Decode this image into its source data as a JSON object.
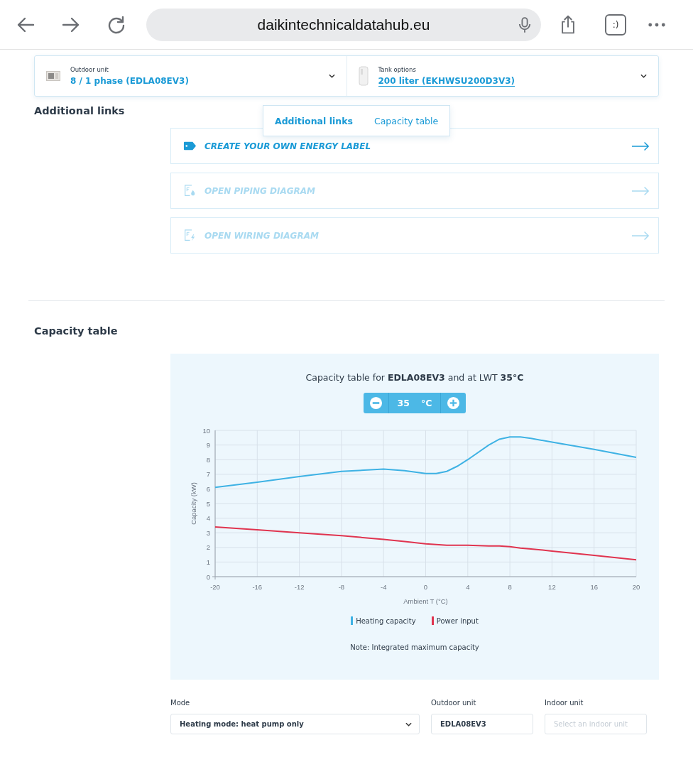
{
  "browser": {
    "url": "daikintechnicaldatahub.eu",
    "tabs_badge": ":)"
  },
  "selectors": [
    {
      "label": "Outdoor unit",
      "value": "8 / 1 phase (EDLA08EV3)",
      "kind": "outdoor"
    },
    {
      "label": "Tank options",
      "value": "200 liter (EKHWSU200D3V3)",
      "kind": "tank"
    }
  ],
  "section_tabs": [
    {
      "label": "Additional links",
      "selected": true
    },
    {
      "label": "Capacity table",
      "selected": false
    }
  ],
  "additional_links": {
    "heading": "Additional links",
    "items": [
      {
        "label": "CREATE YOUR OWN ENERGY LABEL",
        "kind": "tag",
        "disabled": false
      },
      {
        "label": "OPEN PIPING DIAGRAM",
        "kind": "piping",
        "disabled": true
      },
      {
        "label": "OPEN WIRING DIAGRAM",
        "kind": "wiring",
        "disabled": true
      }
    ]
  },
  "capacity": {
    "heading": "Capacity table",
    "title": "Capacity table for **EDLA08EV3** and at LWT **35°C**",
    "stepper": {
      "value": "35",
      "unit": "°C"
    },
    "chart_data": {
      "type": "line",
      "grid": true,
      "xlabel": "Ambient T (°C)",
      "ylabel": "Capacity (kW)",
      "x": [
        -20,
        -16,
        -12,
        -8,
        -4,
        -2,
        0,
        1,
        2,
        3,
        4,
        6,
        7,
        8,
        9,
        10,
        12,
        16,
        20
      ],
      "series": [
        {
          "name": "Heating capacity",
          "color": "#3eb2e4",
          "values": [
            6.1,
            6.45,
            6.85,
            7.2,
            7.35,
            7.25,
            7.05,
            7.05,
            7.2,
            7.55,
            8.0,
            9.0,
            9.4,
            9.55,
            9.55,
            9.45,
            9.2,
            8.7,
            8.15
          ]
        },
        {
          "name": "Power input",
          "color": "#e0344f",
          "values": [
            3.4,
            3.2,
            3.0,
            2.8,
            2.55,
            2.4,
            2.25,
            2.2,
            2.15,
            2.15,
            2.15,
            2.1,
            2.1,
            2.05,
            1.95,
            1.9,
            1.75,
            1.45,
            1.15
          ]
        }
      ],
      "xlim": [
        -20,
        20
      ],
      "ylim": [
        0,
        10
      ],
      "xticks": [
        -20,
        -16,
        -12,
        -8,
        -4,
        0,
        4,
        8,
        12,
        16,
        20
      ],
      "yticks": [
        0,
        1,
        2,
        3,
        4,
        5,
        6,
        7,
        8,
        9,
        10
      ]
    },
    "note": "Note: Integrated maximum capacity"
  },
  "form": {
    "mode": {
      "label": "Mode",
      "value": "Heating mode: heat pump only"
    },
    "outdoor": {
      "label": "Outdoor unit",
      "value": "EDLA08EV3"
    },
    "indoor": {
      "label": "Indoor unit",
      "placeholder": "Select an indoor unit"
    }
  }
}
